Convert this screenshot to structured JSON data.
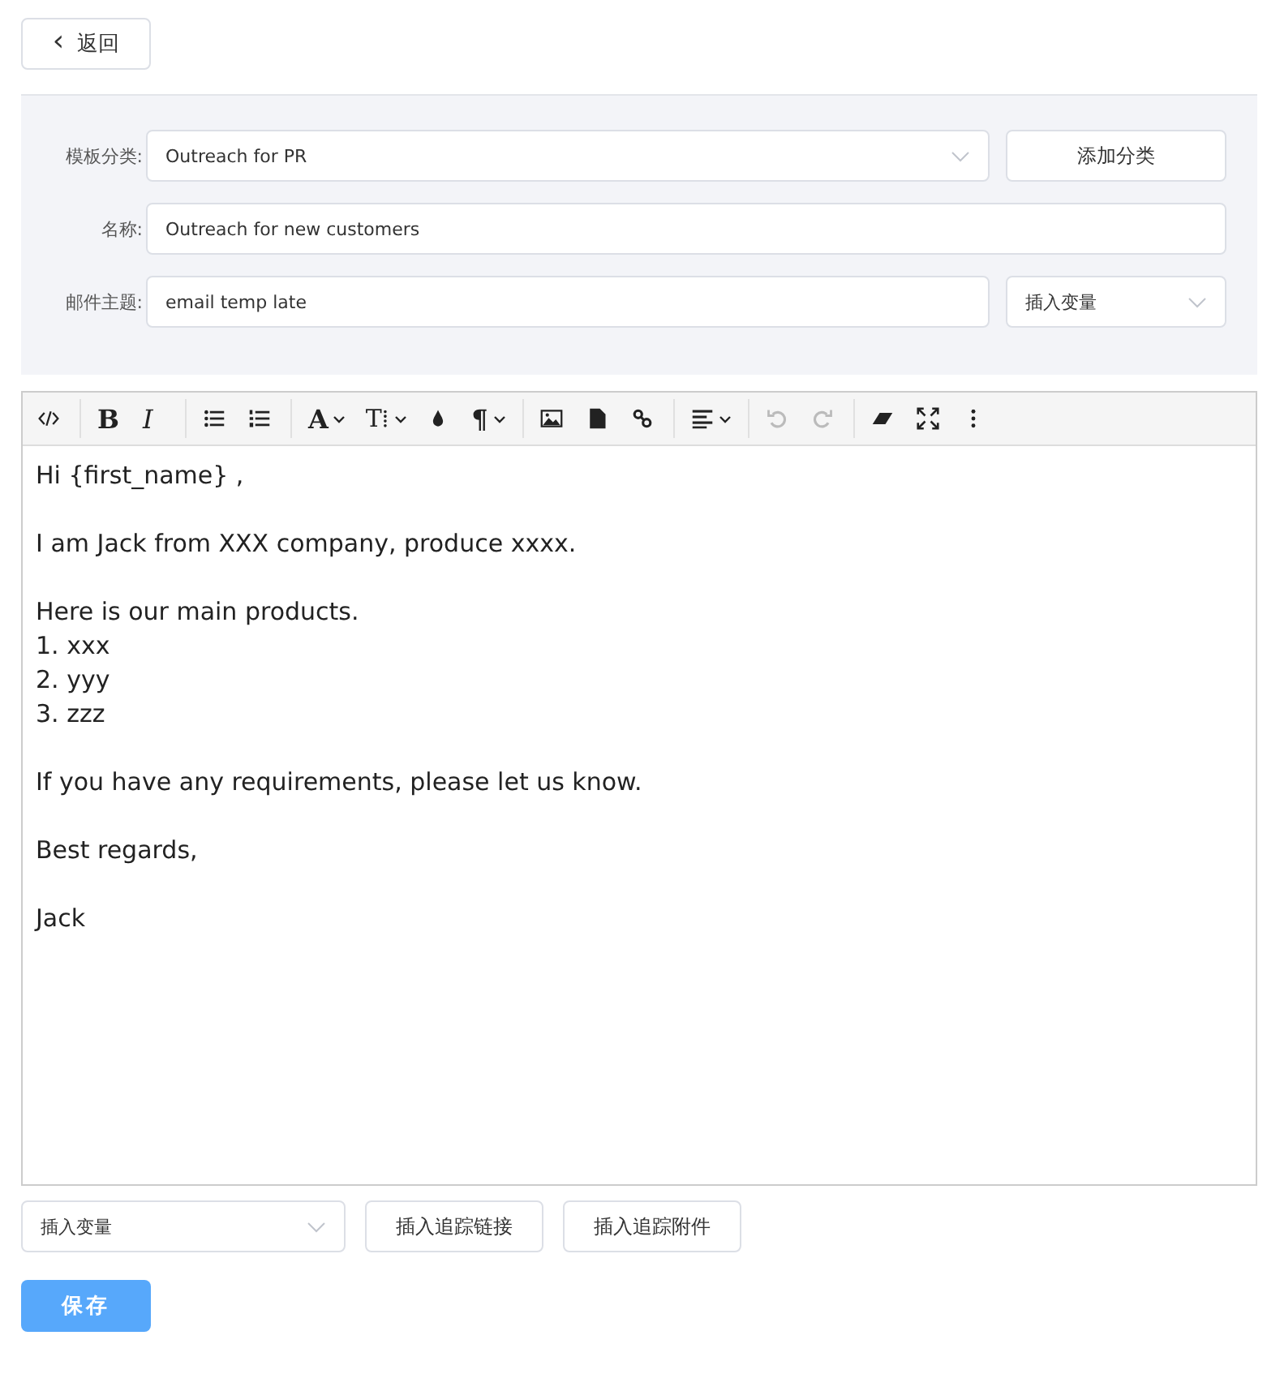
{
  "back_button": {
    "icon": "‹",
    "label": "返回"
  },
  "form": {
    "rows": [
      {
        "kind": "select",
        "label": "模板分类:",
        "value": "Outreach for PR",
        "button": "添加分类"
      },
      {
        "kind": "input",
        "label": "名称:",
        "value": "Outreach for new customers"
      },
      {
        "kind": "input_select",
        "label": "邮件主题:",
        "value": "email temp late",
        "select": "插入变量"
      }
    ]
  },
  "toolbar": {
    "groups": [
      [
        {
          "kind": "icon",
          "dropdown": false,
          "disabled": false
        }
      ],
      [
        {
          "kind": "text",
          "text": "B",
          "dropdown": false,
          "disabled": false
        },
        {
          "kind": "text",
          "text": "I",
          "dropdown": false,
          "disabled": false
        }
      ],
      [
        {
          "kind": "icon",
          "dropdown": false,
          "disabled": false
        },
        {
          "kind": "icon",
          "dropdown": false,
          "disabled": false
        }
      ],
      [
        {
          "kind": "text",
          "text": "A",
          "dropdown": true,
          "disabled": false
        },
        {
          "kind": "text",
          "text": "T⁞",
          "dropdown": true,
          "disabled": false
        },
        {
          "kind": "icon",
          "dropdown": false,
          "disabled": false
        },
        {
          "kind": "text",
          "text": "¶",
          "dropdown": true,
          "disabled": false
        }
      ],
      [
        {
          "kind": "icon",
          "dropdown": false,
          "disabled": false
        },
        {
          "kind": "icon",
          "dropdown": false,
          "disabled": false
        },
        {
          "kind": "icon",
          "dropdown": false,
          "disabled": false
        }
      ],
      [
        {
          "kind": "icon",
          "dropdown": true,
          "disabled": false
        }
      ],
      [
        {
          "kind": "icon",
          "dropdown": false,
          "disabled": true
        },
        {
          "kind": "icon",
          "dropdown": false,
          "disabled": true
        }
      ],
      [
        {
          "kind": "icon",
          "dropdown": false,
          "disabled": false
        },
        {
          "kind": "icon",
          "dropdown": false,
          "disabled": false
        },
        {
          "kind": "icon",
          "dropdown": false,
          "disabled": false
        }
      ]
    ]
  },
  "editor": {
    "paragraphs": [
      [
        "Hi {first_name} ,"
      ],
      [
        "I am Jack from XXX company, produce xxxx."
      ],
      [
        "Here is our main products.",
        "1. xxx",
        "2. yyy",
        "3. zzz"
      ],
      [
        "If you have any requirements, please let us know."
      ],
      [
        "Best regards,"
      ],
      [
        "Jack"
      ]
    ]
  },
  "bottom": {
    "select": "插入变量",
    "buttons": [
      "插入追踪链接",
      "插入追踪附件"
    ]
  },
  "save_button": "保存"
}
